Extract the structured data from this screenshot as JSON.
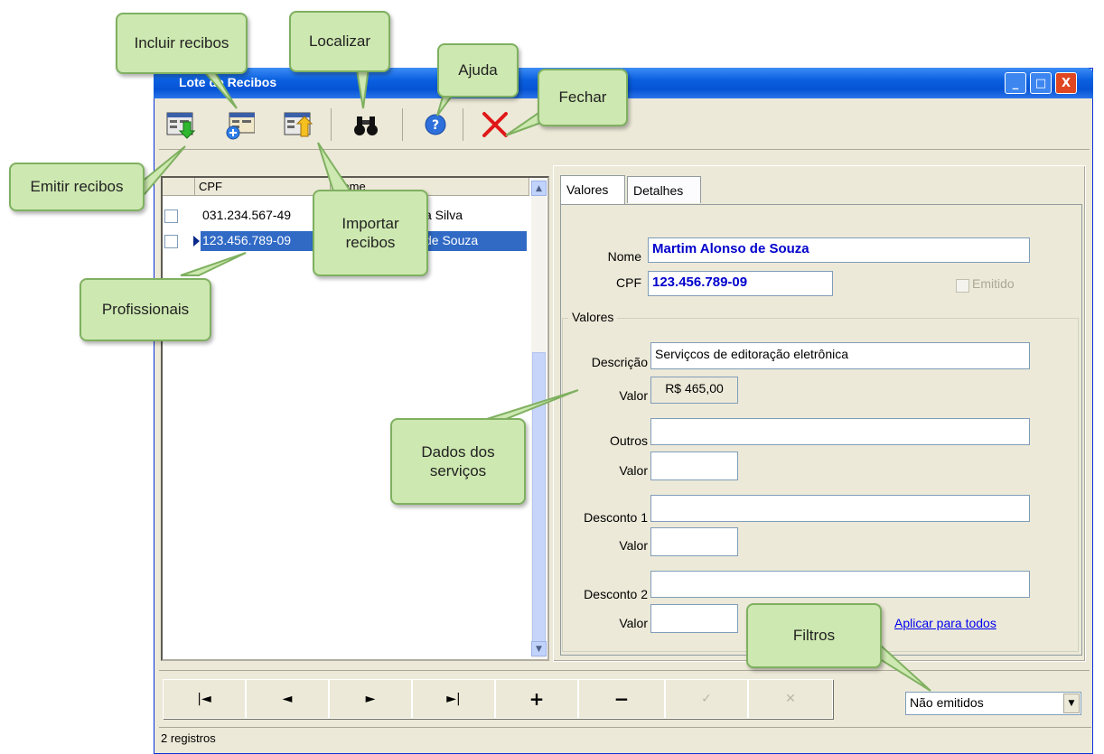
{
  "window": {
    "title": "Lote de Recibos",
    "controls": [
      "_",
      "□",
      "X"
    ]
  },
  "grid": {
    "headers": [
      "CPF",
      "Nome"
    ],
    "rows": [
      {
        "cpf": "031.234.567-49",
        "nome": "a Silva"
      },
      {
        "cpf": "123.456.789-09",
        "nome": "de Souza"
      }
    ]
  },
  "tabs": [
    "Valores",
    "Detalhes"
  ],
  "form": {
    "nome_label": "Nome",
    "nome_value": "Martim Alonso de Souza",
    "cpf_label": "CPF",
    "cpf_value": "123.456.789-09",
    "emitido_label": "Emitido",
    "group_label": "Valores",
    "descricao_label": "Descrição",
    "descricao_value": "Serviçcos de editoração eletrônica",
    "valor1_label": "Valor",
    "valor1_value": "R$ 465,00",
    "outros_label": "Outros",
    "valor2_label": "Valor",
    "desconto1_label": "Desconto 1",
    "valor3_label": "Valor",
    "desconto2_label": "Desconto 2",
    "valor4_label": "Valor",
    "aplicar_link": "Aplicar para todos"
  },
  "nav": {
    "first": "|◄",
    "prev": "◄",
    "next": "►",
    "last": "►|",
    "add": "+",
    "delete": "−",
    "post": "✓",
    "cancel": "✕"
  },
  "filter": {
    "selected": "Não emitidos"
  },
  "status": {
    "text": "2 registros"
  },
  "callouts": {
    "emitir": "Emitir recibos",
    "incluir": "Incluir recibos",
    "localizar": "Localizar",
    "ajuda": "Ajuda",
    "fechar": "Fechar",
    "importar_1": "Importar",
    "importar_2": "recibos",
    "profissionais": "Profissionais",
    "dados_1": "Dados dos",
    "dados_2": "serviços",
    "filtros": "Filtros"
  },
  "colors": {
    "callout_bg": "#cde8b0",
    "callout_border": "#7fb060",
    "selection": "#316ac5",
    "field_text": "#0000cc"
  }
}
